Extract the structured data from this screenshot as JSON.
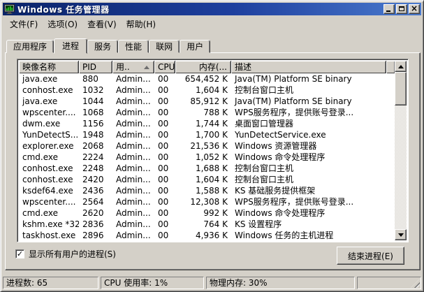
{
  "window": {
    "title": "Windows 任务管理器"
  },
  "colors": {
    "window_bg": "#d4d0c8",
    "titlebar_start": "#0a246a",
    "titlebar_end": "#4a7ace",
    "list_bg": "#ffffff"
  },
  "icons": {
    "app": "task-manager-monitor-icon",
    "minimize": "minimize-icon",
    "maximize": "maximize-icon",
    "close": "close-icon",
    "sort": "sort-ascending-arrow-icon",
    "check": "✓"
  },
  "menu": {
    "items": [
      {
        "label": "文件(F)"
      },
      {
        "label": "选项(O)"
      },
      {
        "label": "查看(V)"
      },
      {
        "label": "帮助(H)"
      }
    ]
  },
  "tabs": [
    {
      "label": "应用程序",
      "active": false
    },
    {
      "label": "进程",
      "active": true
    },
    {
      "label": "服务",
      "active": false
    },
    {
      "label": "性能",
      "active": false
    },
    {
      "label": "联网",
      "active": false
    },
    {
      "label": "用户",
      "active": false
    }
  ],
  "process_table": {
    "columns": [
      {
        "label": "映像名称"
      },
      {
        "label": "PID"
      },
      {
        "label": "用..",
        "sorted": "ascending"
      },
      {
        "label": "CPU"
      },
      {
        "label": "内存(..."
      },
      {
        "label": "描述"
      }
    ],
    "rows": [
      {
        "name": "java.exe",
        "pid": "880",
        "user": "Admin...",
        "cpu": "00",
        "mem": "654,452 K",
        "desc": "Java(TM) Platform SE binary"
      },
      {
        "name": "conhost.exe",
        "pid": "1032",
        "user": "Admin...",
        "cpu": "00",
        "mem": "1,604 K",
        "desc": "控制台窗口主机"
      },
      {
        "name": "java.exe",
        "pid": "1044",
        "user": "Admin...",
        "cpu": "00",
        "mem": "85,912 K",
        "desc": "Java(TM) Platform SE binary"
      },
      {
        "name": "wpscenter....",
        "pid": "1068",
        "user": "Admin...",
        "cpu": "00",
        "mem": "788 K",
        "desc": "WPS服务程序，提供账号登录..."
      },
      {
        "name": "dwm.exe",
        "pid": "1156",
        "user": "Admin...",
        "cpu": "00",
        "mem": "1,744 K",
        "desc": "桌面窗口管理器"
      },
      {
        "name": "YunDetectS...",
        "pid": "1948",
        "user": "Admin...",
        "cpu": "00",
        "mem": "1,700 K",
        "desc": "YunDetectService.exe"
      },
      {
        "name": "explorer.exe",
        "pid": "2068",
        "user": "Admin...",
        "cpu": "00",
        "mem": "21,536 K",
        "desc": "Windows 资源管理器"
      },
      {
        "name": "cmd.exe",
        "pid": "2224",
        "user": "Admin...",
        "cpu": "00",
        "mem": "1,052 K",
        "desc": "Windows 命令处理程序"
      },
      {
        "name": "conhost.exe",
        "pid": "2248",
        "user": "Admin...",
        "cpu": "00",
        "mem": "1,688 K",
        "desc": "控制台窗口主机"
      },
      {
        "name": "conhost.exe",
        "pid": "2420",
        "user": "Admin...",
        "cpu": "00",
        "mem": "1,604 K",
        "desc": "控制台窗口主机"
      },
      {
        "name": "ksdef64.exe",
        "pid": "2436",
        "user": "Admin...",
        "cpu": "00",
        "mem": "1,588 K",
        "desc": "KS 基础服务提供框架"
      },
      {
        "name": "wpscenter....",
        "pid": "2564",
        "user": "Admin...",
        "cpu": "00",
        "mem": "12,308 K",
        "desc": "WPS服务程序，提供账号登录..."
      },
      {
        "name": "cmd.exe",
        "pid": "2620",
        "user": "Admin...",
        "cpu": "00",
        "mem": "992 K",
        "desc": "Windows 命令处理程序"
      },
      {
        "name": "kshm.exe *32",
        "pid": "2836",
        "user": "Admin...",
        "cpu": "00",
        "mem": "764 K",
        "desc": "KS 设置程序"
      },
      {
        "name": "taskhost.exe",
        "pid": "2896",
        "user": "Admin...",
        "cpu": "00",
        "mem": "4,936 K",
        "desc": "Windows 任务的主机进程"
      }
    ]
  },
  "footer": {
    "show_all_label": "显示所有用户的进程(S)",
    "show_all_checked": true,
    "end_process_label": "结束进程(E)"
  },
  "statusbar": {
    "panels": [
      {
        "text": "进程数: 65"
      },
      {
        "text": "CPU 使用率: 1%"
      },
      {
        "text": "物理内存: 30%"
      }
    ]
  }
}
